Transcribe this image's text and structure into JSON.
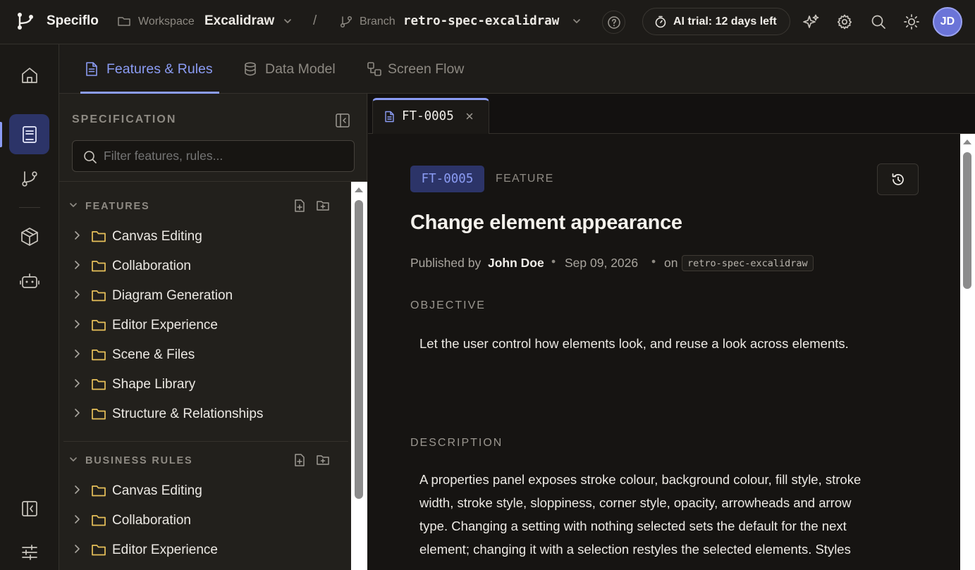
{
  "app": {
    "name": "Speciflo"
  },
  "workspace": {
    "label": "Workspace",
    "value": "Excalidraw"
  },
  "separator": "/",
  "branch": {
    "label": "Branch",
    "value": "retro-spec-excalidraw"
  },
  "ai_trial": {
    "label": "AI trial: 12 days left"
  },
  "user": {
    "initials": "JD"
  },
  "nav_tabs": [
    {
      "label": "Features & Rules",
      "icon": "document-icon",
      "active": true
    },
    {
      "label": "Data Model",
      "icon": "database-icon",
      "active": false
    },
    {
      "label": "Screen Flow",
      "icon": "flow-icon",
      "active": false
    }
  ],
  "sidebar": {
    "title": "SPECIFICATION",
    "filter_placeholder": "Filter features, rules...",
    "features": {
      "title": "FEATURES",
      "items": [
        "Canvas Editing",
        "Collaboration",
        "Diagram Generation",
        "Editor Experience",
        "Scene & Files",
        "Shape Library",
        "Structure & Relationships"
      ]
    },
    "business_rules": {
      "title": "BUSINESS RULES",
      "items": [
        "Canvas Editing",
        "Collaboration",
        "Editor Experience"
      ]
    }
  },
  "doc_tab": {
    "label": "FT-0005"
  },
  "doc": {
    "id": "FT-0005",
    "type": "FEATURE",
    "title": "Change element appearance",
    "published_by_label": "Published by",
    "author": "John Doe",
    "date": "Sep 09, 2026",
    "on_label": "on",
    "branch": "retro-spec-excalidraw",
    "objective_heading": "OBJECTIVE",
    "objective": "Let the user control how elements look, and reuse a look across elements.",
    "description_heading": "DESCRIPTION",
    "description_lines": [
      "A properties panel exposes stroke colour, background colour, fill style, stroke",
      "width, stroke style, sloppiness, corner style, opacity, arrowheads and arrow",
      "type. Changing a setting with nothing selected sets the default for the next",
      "element; changing it with a selection restyles the selected elements. Styles"
    ]
  },
  "colors": {
    "accent": "#8b9cf4",
    "avatar": "#6b74d8",
    "folder": "#e8c15a",
    "id_badge_bg": "#2c3468"
  }
}
